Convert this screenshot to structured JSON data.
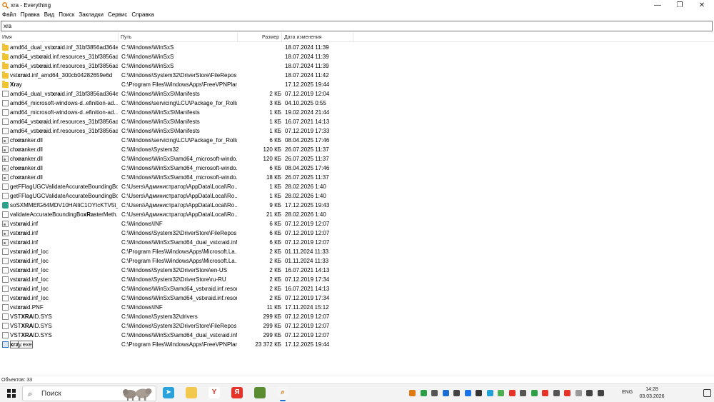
{
  "window": {
    "title": "xra - Everything"
  },
  "menu": [
    "Файл",
    "Правка",
    "Вид",
    "Поиск",
    "Закладки",
    "Сервис",
    "Справка"
  ],
  "search": {
    "value": "xra"
  },
  "columns": {
    "name": "Имя",
    "path": "Путь",
    "size": "Размер",
    "date": "Дата изменения"
  },
  "rows": [
    {
      "pre": "amd64_dual_vst",
      "hl": "xra",
      "post": "id.inf_31bf3856ad364e...",
      "path": "C:\\Windows\\WinSxS",
      "size": "",
      "date": "18.07.2024 11:39",
      "icon": "folder"
    },
    {
      "pre": "amd64_vst",
      "hl": "xra",
      "post": "id.inf.resources_31bf3856ad...",
      "path": "C:\\Windows\\WinSxS",
      "size": "",
      "date": "18.07.2024 11:39",
      "icon": "folder"
    },
    {
      "pre": "amd64_vst",
      "hl": "xra",
      "post": "id.inf.resources_31bf3856ad...",
      "path": "C:\\Windows\\WinSxS",
      "size": "",
      "date": "18.07.2024 11:39",
      "icon": "folder"
    },
    {
      "pre": "vst",
      "hl": "xra",
      "post": "id.inf_amd64_300cb04282659e6d",
      "path": "C:\\Windows\\System32\\DriverStore\\FileRepos...",
      "size": "",
      "date": "18.07.2024 11:42",
      "icon": "folder"
    },
    {
      "pre": "",
      "hl": "Xra",
      "post": "y",
      "path": "C:\\Program Files\\WindowsApps\\FreeVPNPlan...",
      "size": "",
      "date": "17.12.2025 19:44",
      "icon": "folder"
    },
    {
      "pre": "amd64_dual_vst",
      "hl": "xra",
      "post": "id.inf_31bf3856ad364e...",
      "path": "C:\\Windows\\WinSxS\\Manifests",
      "size": "2 КБ",
      "date": "07.12.2019 12:04",
      "icon": "file"
    },
    {
      "pre": "amd64_microsoft-windows-d..efinition-ad...",
      "hl": "",
      "post": "",
      "path": "C:\\Windows\\servicing\\LCU\\Package_for_Rollu...",
      "size": "3 КБ",
      "date": "04.10.2025 0:55",
      "icon": "file"
    },
    {
      "pre": "amd64_microsoft-windows-d..efinition-ad...",
      "hl": "",
      "post": "",
      "path": "C:\\Windows\\WinSxS\\Manifests",
      "size": "1 КБ",
      "date": "19.02.2024 21:44",
      "icon": "file"
    },
    {
      "pre": "amd64_vst",
      "hl": "xra",
      "post": "id.inf.resources_31bf3856ad...",
      "path": "C:\\Windows\\WinSxS\\Manifests",
      "size": "1 КБ",
      "date": "16.07.2021 14:13",
      "icon": "file"
    },
    {
      "pre": "amd64_vst",
      "hl": "xra",
      "post": "id.inf.resources_31bf3856ad...",
      "path": "C:\\Windows\\WinSxS\\Manifests",
      "size": "1 КБ",
      "date": "07.12.2019 17:33",
      "icon": "file"
    },
    {
      "pre": "ch",
      "hl": "xra",
      "post": "nker.dll",
      "path": "C:\\Windows\\servicing\\LCU\\Package_for_Rollu...",
      "size": "6 КБ",
      "date": "08.04.2025 17:46",
      "icon": "dll"
    },
    {
      "pre": "ch",
      "hl": "xra",
      "post": "nker.dll",
      "path": "C:\\Windows\\System32",
      "size": "120 КБ",
      "date": "26.07.2025 11:37",
      "icon": "dll"
    },
    {
      "pre": "ch",
      "hl": "xra",
      "post": "nker.dll",
      "path": "C:\\Windows\\WinSxS\\amd64_microsoft-windo...",
      "size": "120 КБ",
      "date": "26.07.2025 11:37",
      "icon": "dll"
    },
    {
      "pre": "ch",
      "hl": "xra",
      "post": "nker.dll",
      "path": "C:\\Windows\\WinSxS\\amd64_microsoft-windo...",
      "size": "6 КБ",
      "date": "08.04.2025 17:46",
      "icon": "dll"
    },
    {
      "pre": "ch",
      "hl": "xra",
      "post": "nker.dll",
      "path": "C:\\Windows\\WinSxS\\amd64_microsoft-windo...",
      "size": "18 КБ",
      "date": "26.07.2025 11:37",
      "icon": "dll"
    },
    {
      "pre": "getFFlagUGCValidateAccurateBoundingBo...",
      "hl": "",
      "post": "",
      "path": "C:\\Users\\Администратор\\AppData\\Local\\Ro...",
      "size": "1 КБ",
      "date": "28.02.2026 1:40",
      "icon": "file"
    },
    {
      "pre": "getFFlagUGCValidateAccurateBoundingBo...",
      "hl": "",
      "post": "",
      "path": "C:\\Users\\Администратор\\AppData\\Local\\Ro...",
      "size": "1 КБ",
      "date": "28.02.2026 1:40",
      "icon": "file"
    },
    {
      "pre": "soSXMMEfG64MDV10HAlliC1OYIcKTV5t_Z...",
      "hl": "",
      "post": "",
      "path": "C:\\Users\\Администратор\\AppData\\Local\\Ro...",
      "size": "9 КБ",
      "date": "17.12.2025 19:43",
      "icon": "app"
    },
    {
      "pre": "validateAccurateBoundingBo",
      "hl": "xRa",
      "post": "sterMeth...",
      "path": "C:\\Users\\Администратор\\AppData\\Local\\Ro...",
      "size": "21 КБ",
      "date": "28.02.2026 1:40",
      "icon": "file"
    },
    {
      "pre": "vst",
      "hl": "xra",
      "post": "id.inf",
      "path": "C:\\Windows\\INF",
      "size": "6 КБ",
      "date": "07.12.2019 12:07",
      "icon": "dll"
    },
    {
      "pre": "vst",
      "hl": "xra",
      "post": "id.inf",
      "path": "C:\\Windows\\System32\\DriverStore\\FileRepos...",
      "size": "6 КБ",
      "date": "07.12.2019 12:07",
      "icon": "dll"
    },
    {
      "pre": "vst",
      "hl": "xra",
      "post": "id.inf",
      "path": "C:\\Windows\\WinSxS\\amd64_dual_vstxraid.inf...",
      "size": "6 КБ",
      "date": "07.12.2019 12:07",
      "icon": "dll"
    },
    {
      "pre": "vst",
      "hl": "xra",
      "post": "id.inf_loc",
      "path": "C:\\Program Files\\WindowsApps\\Microsoft.La...",
      "size": "2 КБ",
      "date": "01.11.2024 11:33",
      "icon": "file"
    },
    {
      "pre": "vst",
      "hl": "xra",
      "post": "id.inf_loc",
      "path": "C:\\Program Files\\WindowsApps\\Microsoft.La...",
      "size": "2 КБ",
      "date": "01.11.2024 11:33",
      "icon": "file"
    },
    {
      "pre": "vst",
      "hl": "xra",
      "post": "id.inf_loc",
      "path": "C:\\Windows\\System32\\DriverStore\\en-US",
      "size": "2 КБ",
      "date": "16.07.2021 14:13",
      "icon": "file"
    },
    {
      "pre": "vst",
      "hl": "xra",
      "post": "id.inf_loc",
      "path": "C:\\Windows\\System32\\DriverStore\\ru-RU",
      "size": "2 КБ",
      "date": "07.12.2019 17:34",
      "icon": "file"
    },
    {
      "pre": "vst",
      "hl": "xra",
      "post": "id.inf_loc",
      "path": "C:\\Windows\\WinSxS\\amd64_vstxraid.inf.resou...",
      "size": "2 КБ",
      "date": "16.07.2021 14:13",
      "icon": "file"
    },
    {
      "pre": "vst",
      "hl": "xra",
      "post": "id.inf_loc",
      "path": "C:\\Windows\\WinSxS\\amd64_vstxraid.inf.resou...",
      "size": "2 КБ",
      "date": "07.12.2019 17:34",
      "icon": "file"
    },
    {
      "pre": "vst",
      "hl": "xra",
      "post": "id.PNF",
      "path": "C:\\Windows\\INF",
      "size": "11 КБ",
      "date": "17.11.2024 15:12",
      "icon": "file"
    },
    {
      "pre": "VST",
      "hl": "XRA",
      "post": "ID.SYS",
      "path": "C:\\Windows\\System32\\drivers",
      "size": "299 КБ",
      "date": "07.12.2019 12:07",
      "icon": "file"
    },
    {
      "pre": "VST",
      "hl": "XRA",
      "post": "ID.SYS",
      "path": "C:\\Windows\\System32\\DriverStore\\FileRepos...",
      "size": "299 КБ",
      "date": "07.12.2019 12:07",
      "icon": "file"
    },
    {
      "pre": "VST",
      "hl": "XRA",
      "post": "ID.SYS",
      "path": "C:\\Windows\\WinSxS\\amd64_dual_vstxraid.inf...",
      "size": "299 КБ",
      "date": "07.12.2019 12:07",
      "icon": "file"
    },
    {
      "pre": "",
      "hl": "xra",
      "post": "y.exe",
      "path": "C:\\Program Files\\WindowsApps\\FreeVPNPlan...",
      "size": "23 372 КБ",
      "date": "17.12.2025 19:44",
      "icon": "exe",
      "selected": true
    }
  ],
  "status": {
    "text": "Объектов: 33"
  },
  "taskbar": {
    "search_label": "Поиск",
    "language": "ENG",
    "time": "14:28",
    "date": "03.03.2026",
    "apps": [
      {
        "name": "telegram-icon",
        "color": "#2aa3dd",
        "glyph": "➤"
      },
      {
        "name": "file-explorer-icon",
        "color": "#f2c94c",
        "glyph": ""
      },
      {
        "name": "yandex-browser-icon",
        "color": "#ffffff",
        "glyph": "Y",
        "fg": "#e5332a"
      },
      {
        "name": "yandex-icon",
        "color": "#e5332a",
        "glyph": "Я"
      },
      {
        "name": "minecraft-icon",
        "color": "#5b8c32",
        "glyph": ""
      },
      {
        "name": "everything-icon",
        "color": "#f5f5f5",
        "glyph": "⌕",
        "fg": "#e07b14",
        "active": true
      }
    ],
    "tray_colors": [
      "#e07b14",
      "#2e9e47",
      "#555555",
      "#1c6dd0",
      "#444444",
      "#1a73e8",
      "#333333",
      "#22a0d8",
      "#4caf50",
      "#e5332a",
      "#555555",
      "#2e9e47",
      "#e5332a",
      "#555555",
      "#e5332a",
      "#999999",
      "#444444",
      "#444444"
    ]
  }
}
